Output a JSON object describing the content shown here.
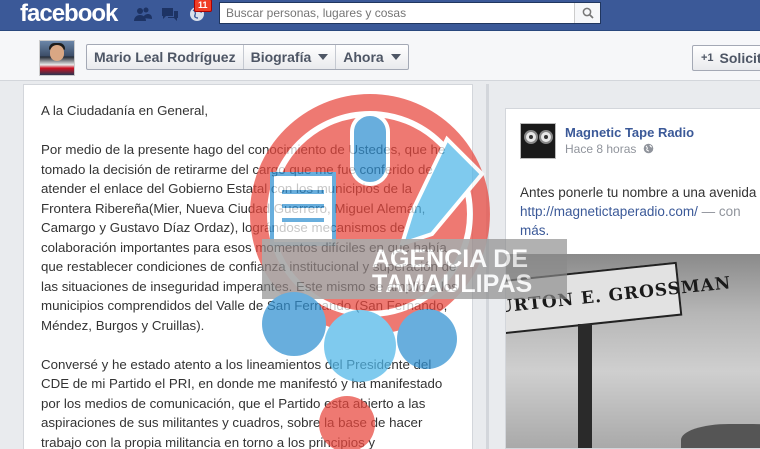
{
  "topbar": {
    "logo": "facebook",
    "notifications_count": "11",
    "search_placeholder": "Buscar personas, lugares y cosas"
  },
  "profile": {
    "name": "Mario Leal Rodríguez",
    "nav": [
      {
        "label": "Biografía"
      },
      {
        "label": "Ahora"
      }
    ],
    "request_label": "Solicit",
    "request_icon": "+1"
  },
  "letter": {
    "paragraphs": [
      "A la Ciudadanía en General,",
      "Por medio de la presente hago del conocimiento de Ustedes, que he tomado la decisión de retirarme del cargo que me fue conferido de atender el enlace del Gobierno Estatal con los municipios de la Frontera Ribereña(Mier, Nueva Ciudad Guerrero, Miguel Alemán, Camargo y Gustavo Díaz Ordaz), lográndose mecanismos de colaboración importantes para esos momentos difíciles en que había que restablecer condiciones de confianza institucional y superación de las situaciones de inseguridad imperantes. Este mismo se amplió a los municipios comprendidos del Valle de San Fernando (San Fernando, Méndez, Burgos y Cruillas).",
      "Conversé y he estado atento a los lineamientos del Presidente del CDE de mi Partido el PRI, en donde me manifestó y ha manifestado por los medios de comunicación, que el Partido esta abierto a las aspiraciones de sus militantes y cuadros, sobre la base de hacer trabajo con la propia militancia en torno a los principios y"
    ]
  },
  "post": {
    "page_name": "Magnetic Tape Radio",
    "time": "Hace 8 horas",
    "text_line1": "Antes ponerle tu nombre a una avenida",
    "link": "http://magnetictaperadio.com/",
    "link_suffix": " — con",
    "more": "más.",
    "photo_sign": "LA BURTON E. GROSSMAN"
  },
  "watermark": {
    "line1": "AGENCIA DE",
    "line2": "TAMAULIPAS",
    "colors": {
      "red": "#e8463c",
      "blue": "#2f8fd0",
      "light_blue": "#4fb6e8"
    }
  },
  "colors": {
    "facebook_blue": "#3b5998",
    "link_blue": "#3b5998",
    "badge_red": "#f03d25"
  }
}
